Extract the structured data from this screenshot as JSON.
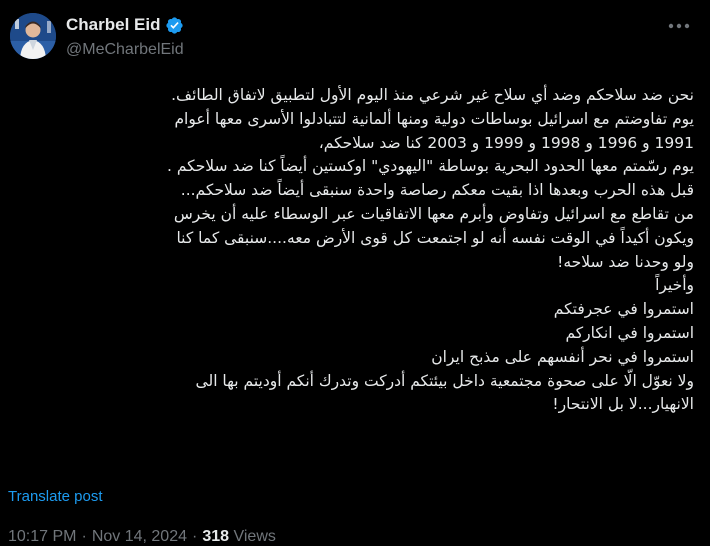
{
  "author": {
    "display_name": "Charbel Eid",
    "handle": "@MeCharbelEid",
    "verified": true,
    "avatar_icon": "profile-photo",
    "verified_icon": "verified-badge-icon"
  },
  "menu": {
    "icon": "more-horizontal-icon"
  },
  "tweet": {
    "lines": [
      "نحن ضد سلاحكم وضد أي سلاح غير شرعي منذ اليوم الأول لتطبيق لاتفاق الطائف.",
      "يوم تفاوضتم مع اسرائيل بوساطات دولية ومنها ألمانية لتتبادلوا الأسرى معها أعوام",
      "1991 و 1996 و 1998 و 1999 و 2003 كنا ضد سلاحكم،",
      "يوم رسّمتم معها الحدود البحرية بوساطة \"اليهودي\" اوكستين أيضاً كنا ضد سلاحكم .",
      "قبل هذه الحرب وبعدها اذا بقيت معكم رصاصة واحدة سنبقى أيضاً ضد سلاحكم...",
      "من تقاطع مع اسرائيل وتفاوض  وأبرم معها الاتفاقيات عبر الوسطاء عليه أن يخرس",
      "ويكون أكيداً في الوقت نفسه أنه لو اجتمعت كل قوى الأرض معه....سنبقى كما كنا",
      "ولو وحدنا ضد سلاحه!",
      "وأخيراً",
      "استمروا في عجرفتكم",
      "استمروا في انكاركم",
      "استمروا في نحر أنفسهم على مذبح ايران",
      "ولا نعوّل الّا على صحوة مجتمعية داخل بيئتكم أدركت وتدرك أنكم أوديتم بها الى",
      "الانهيار...لا بل الانتحار!"
    ],
    "translate_label": "Translate post"
  },
  "meta": {
    "time": "10:17 PM",
    "separator": "·",
    "date": "Nov 14, 2024",
    "views_count": "318",
    "views_label": "Views"
  },
  "colors": {
    "background": "#000000",
    "text": "#e7e9ea",
    "secondary": "#71767b",
    "accent": "#1d9bf0"
  }
}
